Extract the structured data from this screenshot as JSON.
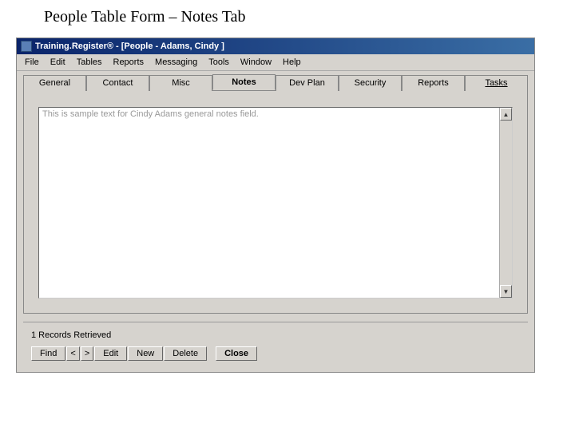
{
  "page_heading": "People Table Form – Notes Tab",
  "window": {
    "title": "Training.Register® - [People - Adams, Cindy ]"
  },
  "menu": {
    "items": [
      "File",
      "Edit",
      "Tables",
      "Reports",
      "Messaging",
      "Tools",
      "Window",
      "Help"
    ]
  },
  "tabs": {
    "items": [
      {
        "label": "General"
      },
      {
        "label": "Contact"
      },
      {
        "label": "Misc"
      },
      {
        "label": "Notes",
        "active": true
      },
      {
        "label": "Dev Plan"
      },
      {
        "label": "Security"
      },
      {
        "label": "Reports"
      },
      {
        "label": "Tasks",
        "underlined": true
      }
    ]
  },
  "notes": {
    "text": "This is sample text for Cindy Adams general notes field."
  },
  "status": {
    "records": "1 Records Retrieved"
  },
  "buttons": {
    "find": "Find",
    "prev": "<",
    "next": ">",
    "edit": "Edit",
    "new": "New",
    "delete": "Delete",
    "close": "Close"
  },
  "scroll": {
    "up": "▲",
    "down": "▼"
  }
}
